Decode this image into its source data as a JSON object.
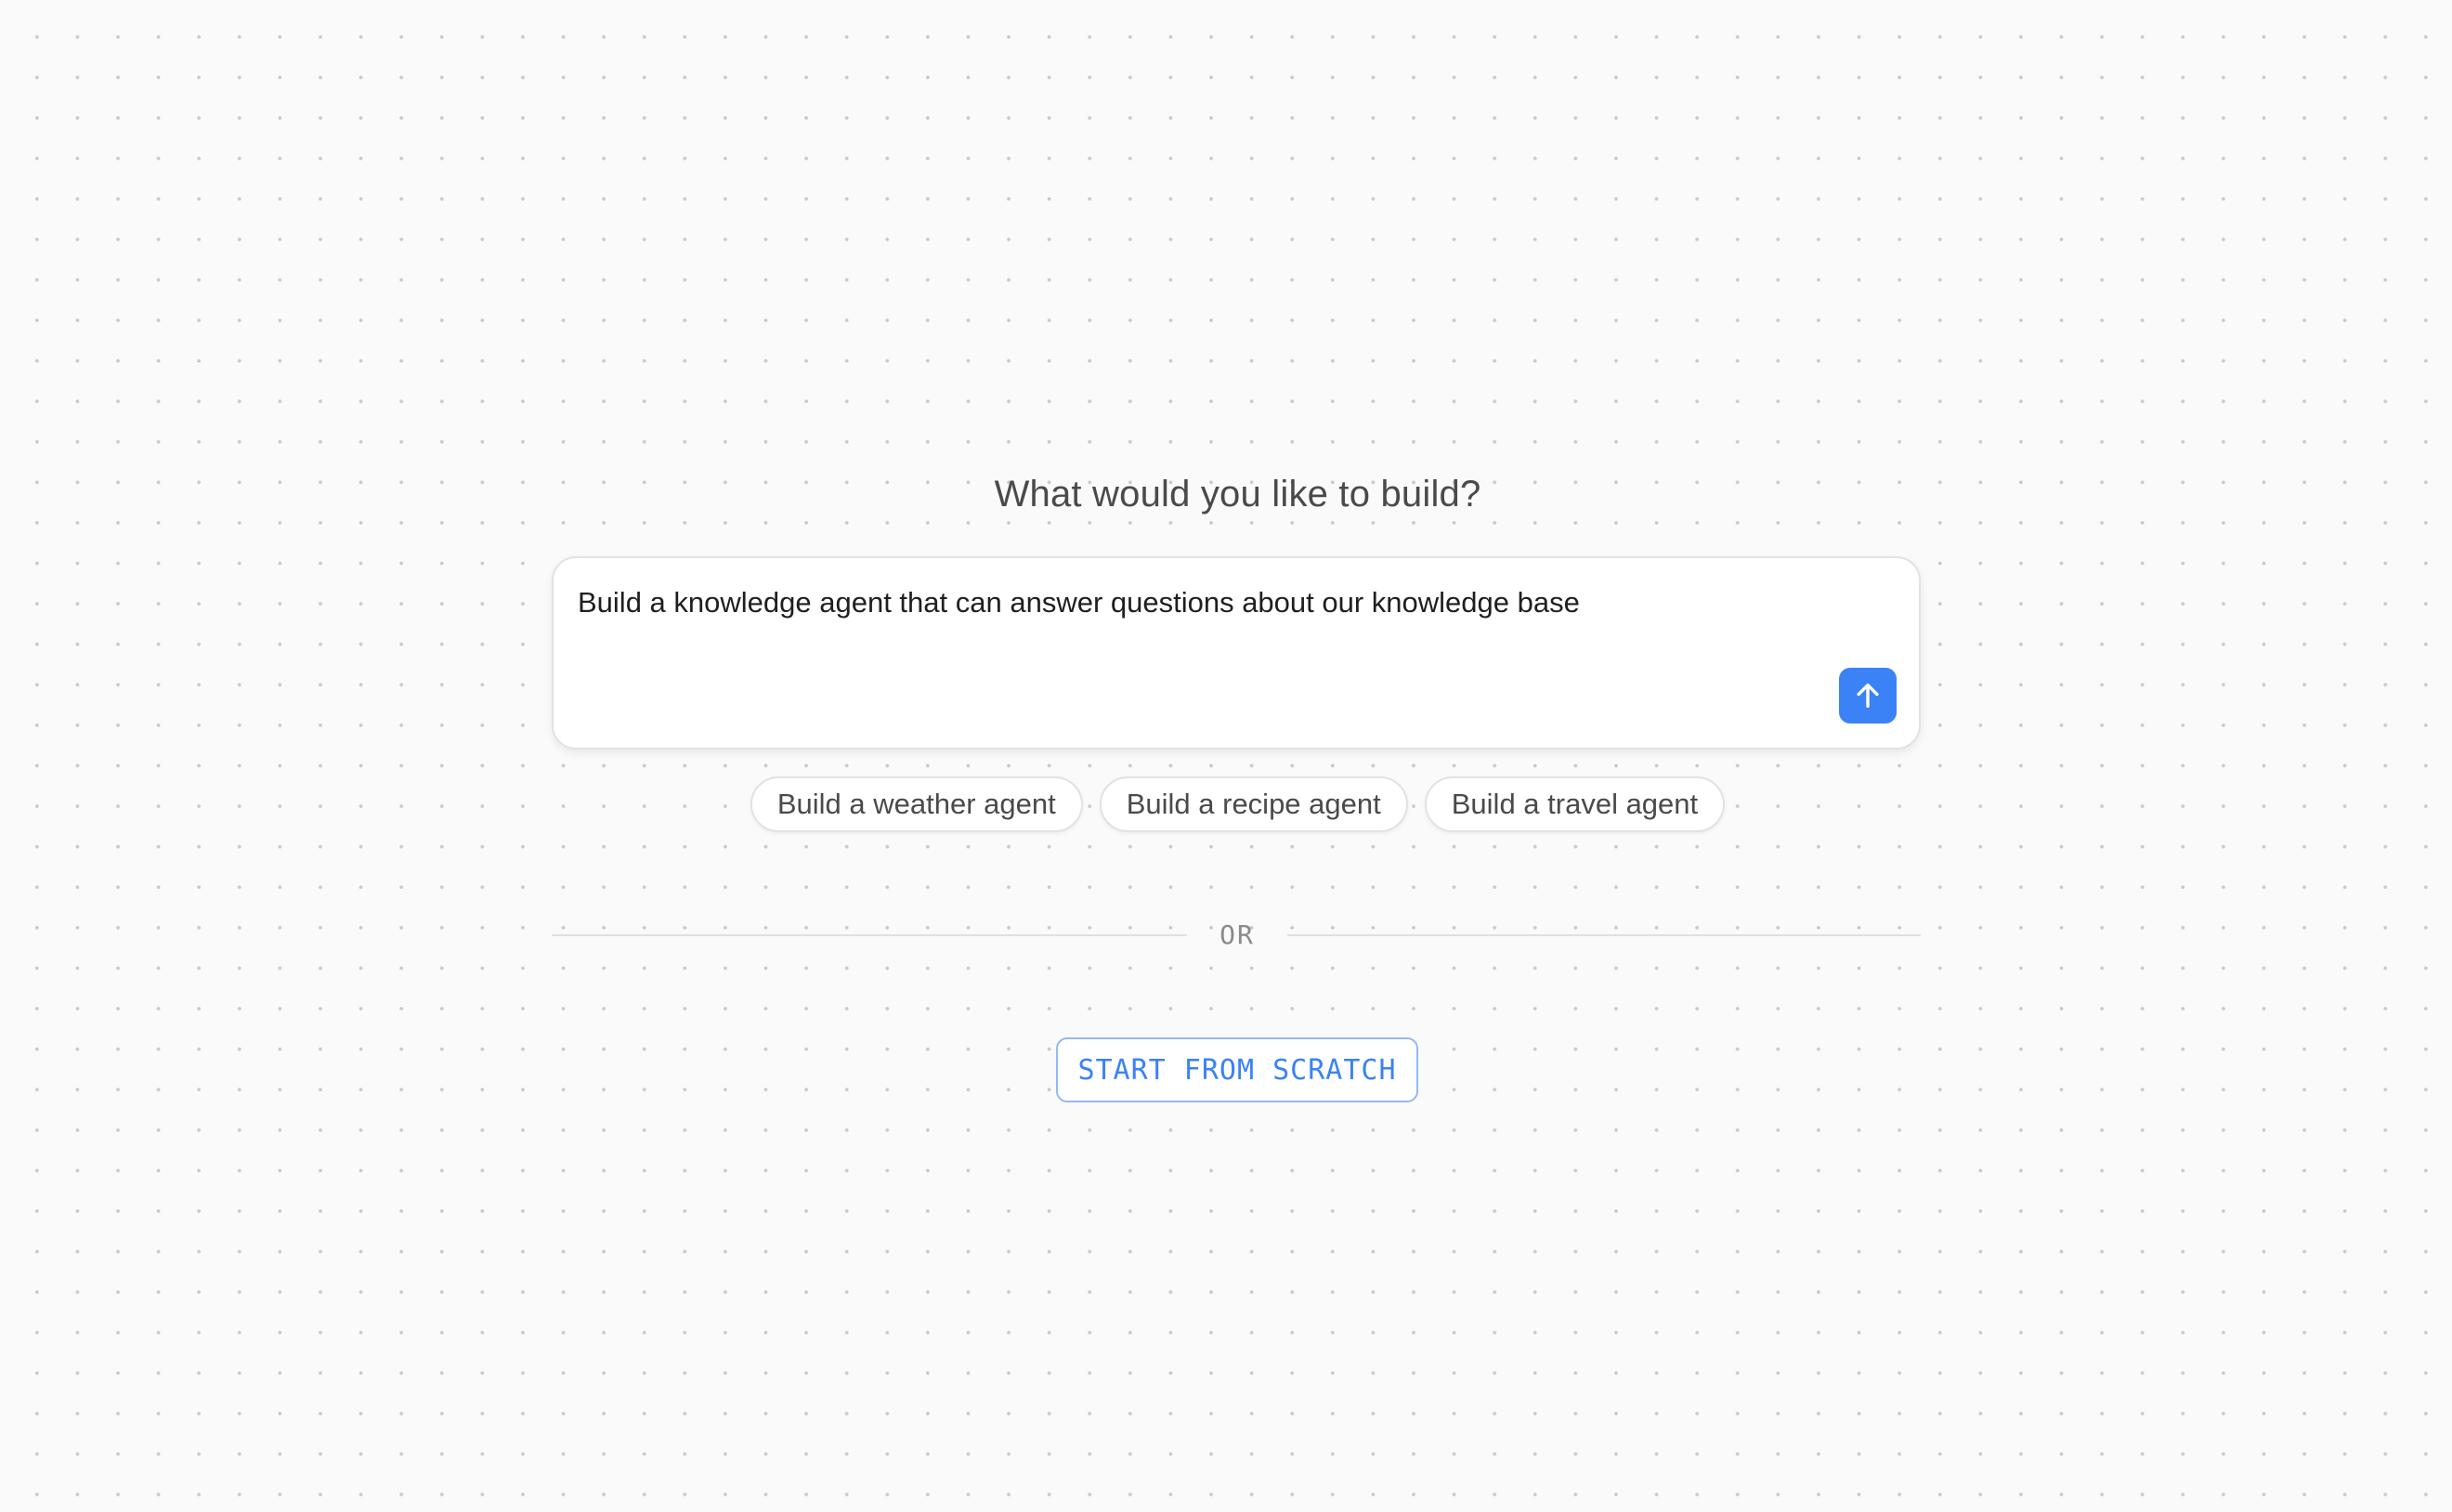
{
  "heading": "What would you like to build?",
  "prompt": {
    "value": "Build a knowledge agent that can answer questions about our knowledge base",
    "send_icon": "arrow-up-icon"
  },
  "suggestions": [
    {
      "label": "Build a weather agent"
    },
    {
      "label": "Build a recipe agent"
    },
    {
      "label": "Build a travel agent"
    }
  ],
  "divider": {
    "label": "OR"
  },
  "scratch_button": {
    "label": "START FROM SCRATCH"
  },
  "colors": {
    "accent": "#3b82f6",
    "background": "#fafafa",
    "text": "#4a4a4a"
  }
}
